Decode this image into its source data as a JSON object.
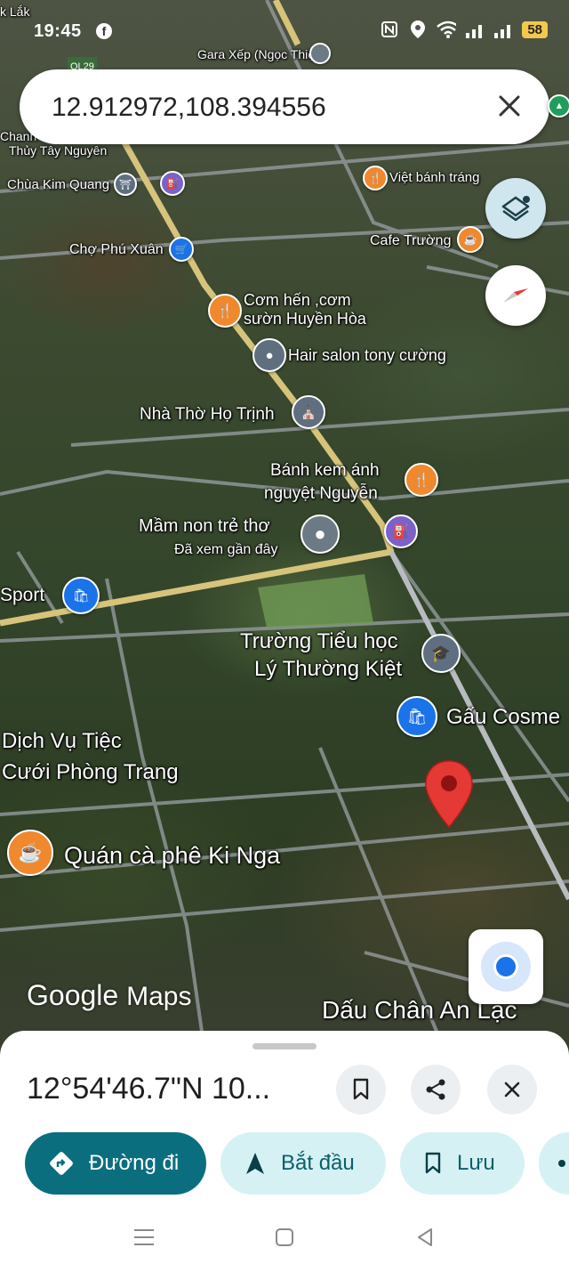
{
  "status": {
    "time": "19:45",
    "battery": "58"
  },
  "search": {
    "query": "12.912972,108.394556"
  },
  "map": {
    "top_labels": {
      "lak": "k Lắk",
      "ql29": "QL29",
      "gara": "Gara Xếp (Ngọc Thiện)"
    },
    "places": {
      "chanh": "Chanh",
      "thuy": "Thủy Tây Nguyên",
      "kim_quang": "Chùa Kim Quang",
      "viet_banh_trang": "Việt bánh tráng",
      "cho_phu_xuan": "Chợ Phú Xuân",
      "cafe_truong": "Cafe Trường",
      "com_hen_1": "Cơm hến ,cơm",
      "com_hen_2": "sườn Huyền Hòa",
      "hair_salon": "Hair salon tony cường",
      "nha_tho": "Nhà Thờ Họ Trịnh",
      "banh_kem_1": "Bánh kem ánh",
      "banh_kem_2": "nguyệt Nguyễn",
      "mam_non": "Mầm non trẻ thơ",
      "mam_non_sub": "Đã xem gần đây",
      "sport": "Sport",
      "truong_1": "Trường Tiểu học",
      "truong_2": "Lý Thường Kiệt",
      "gau": "Gấu Cosme",
      "dich_vu_1": "Dịch Vụ Tiệc",
      "dich_vu_2": "Cưới Phòng Trang",
      "quan_ca_phe": "Quán cà phê Ki Nga",
      "dau_chan": "Dấu Chân An Lạc"
    },
    "logo_google": "Google",
    "logo_maps": "Maps"
  },
  "sheet": {
    "coordinates": "12°54'46.7\"N 10...",
    "actions": {
      "directions": "Đường đi",
      "start": "Bắt đầu",
      "save": "Lưu"
    }
  },
  "colors": {
    "primary": "#0b6e7e",
    "chip_bg": "#d6f1f4",
    "pin_red": "#e53935"
  }
}
